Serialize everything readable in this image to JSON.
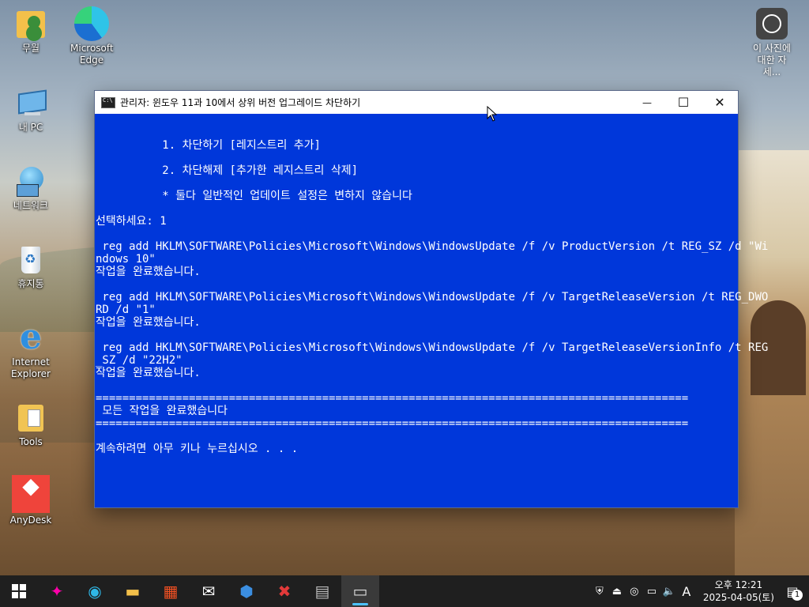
{
  "desktop": {
    "icons": [
      {
        "label": "무월"
      },
      {
        "label": "Microsoft Edge"
      },
      {
        "label": "내 PC"
      },
      {
        "label": "네트워크"
      },
      {
        "label": "휴지통"
      },
      {
        "label": "Internet Explorer"
      },
      {
        "label": "Tools"
      },
      {
        "label": "AnyDesk"
      }
    ],
    "spotlight_label": "이 사진에 대한 자세..."
  },
  "window": {
    "title": "관리자:  윈도우 11과 10에서 상위 버전 업그레이드 차단하기",
    "buttons": {
      "minimize": "—",
      "maximize": "☐",
      "close": "✕"
    },
    "console_lines": [
      "",
      "",
      "          1. 차단하기 [레지스트리 추가]",
      "",
      "          2. 차단해제 [추가한 레지스트리 삭제]",
      "",
      "          * 둘다 일반적인 업데이트 설정은 변하지 않습니다",
      "",
      "선택하세요: 1",
      "",
      " reg add HKLM\\SOFTWARE\\Policies\\Microsoft\\Windows\\WindowsUpdate /f /v ProductVersion /t REG_SZ /d \"Wi",
      "ndows 10\"",
      "작업을 완료했습니다.",
      "",
      " reg add HKLM\\SOFTWARE\\Policies\\Microsoft\\Windows\\WindowsUpdate /f /v TargetReleaseVersion /t REG_DWO",
      "RD /d \"1\"",
      "작업을 완료했습니다.",
      "",
      " reg add HKLM\\SOFTWARE\\Policies\\Microsoft\\Windows\\WindowsUpdate /f /v TargetReleaseVersionInfo /t REG",
      "_SZ /d \"22H2\"",
      "작업을 완료했습니다.",
      "",
      "=========================================================================================",
      " 모든 작업을 완료했습니다",
      "=========================================================================================",
      "",
      "계속하려면 아무 키나 누르십시오 . . ."
    ]
  },
  "taskbar": {
    "apps": [
      {
        "name": "start",
        "glyph": ""
      },
      {
        "name": "copilot",
        "glyph": "✦"
      },
      {
        "name": "edge",
        "glyph": "◉"
      },
      {
        "name": "file-explorer",
        "glyph": "▬"
      },
      {
        "name": "store",
        "glyph": "▦"
      },
      {
        "name": "mail",
        "glyph": "✉"
      },
      {
        "name": "network-tool",
        "glyph": "⬢"
      },
      {
        "name": "security",
        "glyph": "✖"
      },
      {
        "name": "printer-tool",
        "glyph": "▤"
      },
      {
        "name": "terminal",
        "glyph": "▭"
      }
    ],
    "tray": {
      "ime": "A",
      "time": "오후 12:21",
      "date": "2025-04-05(토)",
      "notification_count": "1"
    }
  }
}
